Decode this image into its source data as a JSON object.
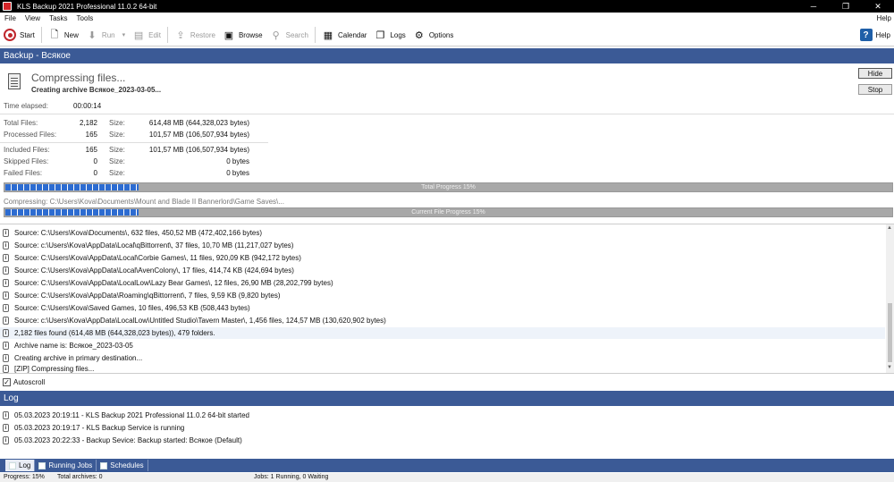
{
  "window": {
    "title": "KLS Backup 2021 Professional 11.0.2 64-bit",
    "minimize": "─",
    "maximize": "❐",
    "close": "✕"
  },
  "menu": {
    "items": [
      "File",
      "View",
      "Tasks",
      "Tools"
    ],
    "help": "Help"
  },
  "toolbar": {
    "start": "Start",
    "new": "New",
    "run": "Run",
    "edit": "Edit",
    "restore": "Restore",
    "browse": "Browse",
    "search": "Search",
    "calendar": "Calendar",
    "logs": "Logs",
    "options": "Options",
    "help": "Help"
  },
  "backup": {
    "header": "Backup - Всякое",
    "status": "Compressing files...",
    "substatus": "Creating archive Всякое_2023-03-05...",
    "hide_label": "Hide",
    "stop_label": "Stop",
    "elapsed_label": "Time elapsed:",
    "elapsed": "00:00:14",
    "size_label": "Size:",
    "stats": [
      {
        "label": "Total Files:",
        "count": "2,182",
        "size": "614,48 MB (644,328,023 bytes)"
      },
      {
        "label": "Processed Files:",
        "count": "165",
        "size": "101,57 MB (106,507,934 bytes)"
      },
      {
        "label": "Included Files:",
        "count": "165",
        "size": "101,57 MB (106,507,934 bytes)"
      },
      {
        "label": "Skipped Files:",
        "count": "0",
        "size": "0 bytes"
      },
      {
        "label": "Failed Files:",
        "count": "0",
        "size": "0 bytes"
      }
    ],
    "total_progress": {
      "label": "Total Progress 15%",
      "value": 0.15
    },
    "compressing": "Compressing: C:\\Users\\Kova\\Documents\\Mount and Blade II Bannerlord\\Game Saves\\...",
    "file_progress": {
      "label": "Current File Progress 15%",
      "value": 0.15
    }
  },
  "messages": [
    "Source: C:\\Users\\Kova\\Documents\\, 632 files, 450,52 MB (472,402,166 bytes)",
    "Source: c:\\Users\\Kova\\AppData\\Local\\qBittorrent\\, 37 files, 10,70 MB (11,217,027 bytes)",
    "Source: C:\\Users\\Kova\\AppData\\Local\\Corbie Games\\, 11 files, 920,09 KB (942,172 bytes)",
    "Source: C:\\Users\\Kova\\AppData\\Local\\AvenColony\\, 17 files, 414,74 KB (424,694 bytes)",
    "Source: C:\\Users\\Kova\\AppData\\LocalLow\\Lazy Bear Games\\, 12 files, 26,90 MB (28,202,799 bytes)",
    "Source: C:\\Users\\Kova\\AppData\\Roaming\\qBittorrent\\, 7 files, 9,59 KB (9,820 bytes)",
    "Source: C:\\Users\\Kova\\Saved Games, 10 files, 496,53 KB (508,443 bytes)",
    "Source: c:\\Users\\Kova\\AppData\\LocalLow\\Untitled Studio\\Tavern Master\\, 1,456 files, 124,57 MB (130,620,902 bytes)",
    "2,182 files found (614,48 MB (644,328,023 bytes)), 479 folders.",
    "Archive name is: Всякое_2023-03-05",
    "Creating archive in primary destination...",
    "[ZIP] Compressing files..."
  ],
  "autoscroll_label": "Autoscroll",
  "log": {
    "header": "Log",
    "entries": [
      "05.03.2023 20:19:11 - KLS Backup 2021 Professional 11.0.2 64-bit started",
      "05.03.2023 20:19:17 - KLS Backup Service is running",
      "05.03.2023 20:22:33 - Backup Sevice: Backup started: Всякое (Default)"
    ]
  },
  "tabs": [
    "Log",
    "Running Jobs",
    "Schedules"
  ],
  "statusbar": {
    "progress": "Progress: 15%",
    "archives": "Total archives: 0",
    "jobs": "Jobs: 1 Running, 0 Waiting"
  }
}
